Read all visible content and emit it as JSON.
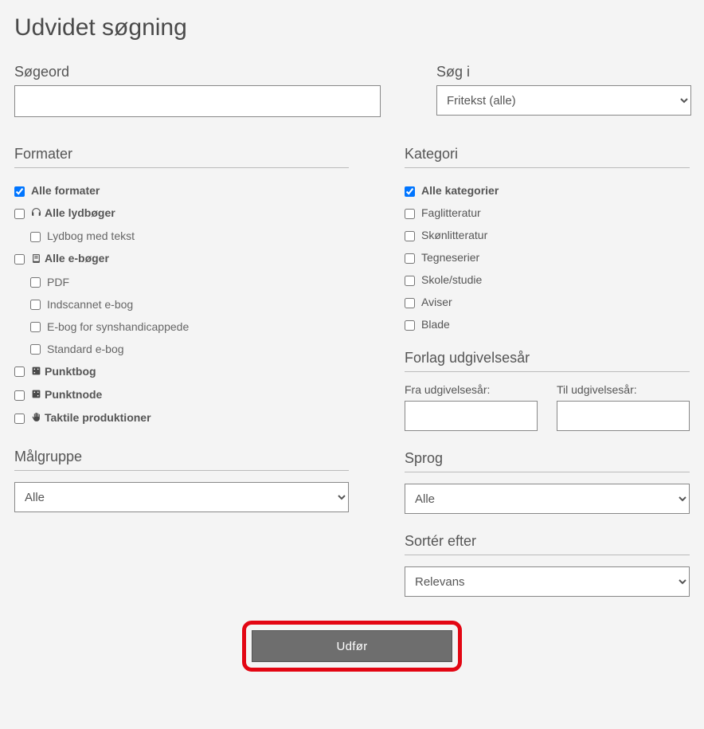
{
  "title": "Udvidet søgning",
  "search": {
    "label": "Søgeord",
    "value": "",
    "inLabel": "Søg i",
    "inSelected": "Fritekst (alle)"
  },
  "formats": {
    "heading": "Formater",
    "items": [
      {
        "label": "Alle formater",
        "checked": true,
        "bold": true,
        "indent": 0,
        "icon": null
      },
      {
        "label": "Alle lydbøger",
        "checked": false,
        "bold": true,
        "indent": 0,
        "icon": "headphones"
      },
      {
        "label": "Lydbog med tekst",
        "checked": false,
        "bold": false,
        "indent": 1,
        "icon": null
      },
      {
        "label": "Alle e-bøger",
        "checked": false,
        "bold": true,
        "indent": 0,
        "icon": "book"
      },
      {
        "label": "PDF",
        "checked": false,
        "bold": false,
        "indent": 1,
        "icon": null
      },
      {
        "label": "Indscannet e-bog",
        "checked": false,
        "bold": false,
        "indent": 1,
        "icon": null
      },
      {
        "label": "E-bog for synshandicappede",
        "checked": false,
        "bold": false,
        "indent": 1,
        "icon": null
      },
      {
        "label": "Standard e-bog",
        "checked": false,
        "bold": false,
        "indent": 1,
        "icon": null
      },
      {
        "label": "Punktbog",
        "checked": false,
        "bold": true,
        "indent": 0,
        "icon": "braille"
      },
      {
        "label": "Punktnode",
        "checked": false,
        "bold": true,
        "indent": 0,
        "icon": "braille-note"
      },
      {
        "label": "Taktile produktioner",
        "checked": false,
        "bold": true,
        "indent": 0,
        "icon": "hand"
      }
    ]
  },
  "audience": {
    "heading": "Målgruppe",
    "selected": "Alle"
  },
  "category": {
    "heading": "Kategori",
    "items": [
      {
        "label": "Alle kategorier",
        "checked": true,
        "bold": true
      },
      {
        "label": "Faglitteratur",
        "checked": false,
        "bold": false
      },
      {
        "label": "Skønlitteratur",
        "checked": false,
        "bold": false
      },
      {
        "label": "Tegneserier",
        "checked": false,
        "bold": false
      },
      {
        "label": "Skole/studie",
        "checked": false,
        "bold": false
      },
      {
        "label": "Aviser",
        "checked": false,
        "bold": false
      },
      {
        "label": "Blade",
        "checked": false,
        "bold": false
      }
    ]
  },
  "publisher": {
    "heading": "Forlag udgivelsesår",
    "fromLabel": "Fra udgivelsesår:",
    "toLabel": "Til udgivelsesår:",
    "fromValue": "",
    "toValue": ""
  },
  "language": {
    "heading": "Sprog",
    "selected": "Alle"
  },
  "sort": {
    "heading": "Sortér efter",
    "selected": "Relevans"
  },
  "submit": {
    "label": "Udfør"
  }
}
